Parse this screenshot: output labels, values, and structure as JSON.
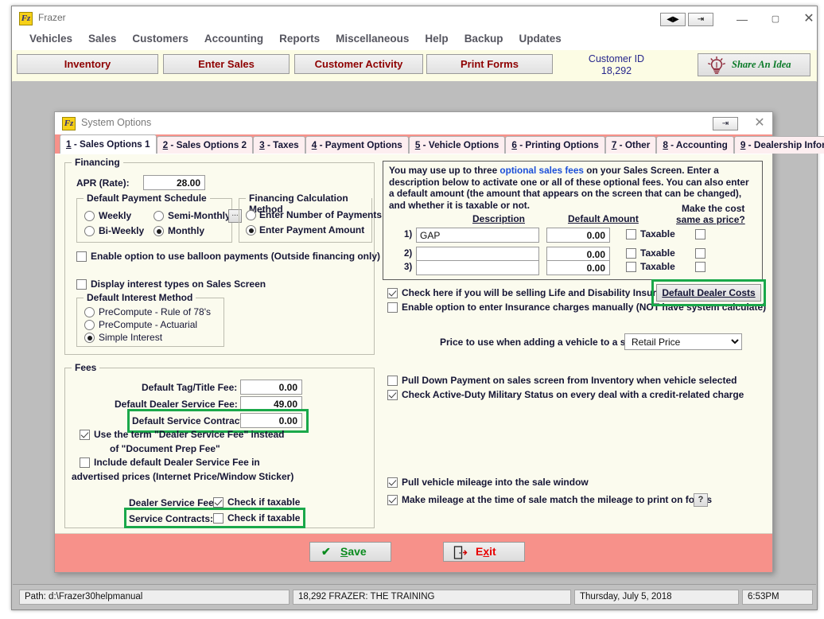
{
  "app": {
    "title": "Frazer",
    "icon": "frazer-logo-icon",
    "window_controls": {
      "restore_small": "◀▶",
      "popout": "⇥",
      "minimize": "—",
      "maximize": "▢",
      "close": "✕"
    }
  },
  "menubar": [
    {
      "label": "Vehicles"
    },
    {
      "label": "Sales"
    },
    {
      "label": "Customers"
    },
    {
      "label": "Accounting"
    },
    {
      "label": "Reports"
    },
    {
      "label": "Miscellaneous"
    },
    {
      "label": "Help"
    },
    {
      "label": "Backup"
    },
    {
      "label": "Updates"
    }
  ],
  "toolbar": {
    "inventory": "Inventory",
    "enter_sales": "Enter Sales",
    "customer_activity": "Customer Activity",
    "print_forms": "Print Forms",
    "customer_id_label": "Customer ID",
    "customer_id_value": "18,292",
    "share_idea": "Share An Idea"
  },
  "dialog": {
    "title": "System Options",
    "popout": "⇥",
    "close": "✕",
    "tabs": [
      {
        "num": "1",
        "label": " - Sales Options 1",
        "active": true
      },
      {
        "num": "2",
        "label": " - Sales Options 2",
        "active": false
      },
      {
        "num": "3",
        "label": " - Taxes",
        "active": false
      },
      {
        "num": "4",
        "label": " - Payment Options",
        "active": false
      },
      {
        "num": "5",
        "label": " - Vehicle Options",
        "active": false
      },
      {
        "num": "6",
        "label": " - Printing Options",
        "active": false
      },
      {
        "num": "7",
        "label": " - Other",
        "active": false
      },
      {
        "num": "8",
        "label": " - Accounting",
        "active": false
      },
      {
        "num": "9",
        "label": " - Dealership Information",
        "active": false
      }
    ]
  },
  "financing": {
    "group_title": "Financing",
    "apr_label": "APR (Rate):",
    "apr_value": "28.00",
    "schedule": {
      "title": "Default Payment Schedule",
      "options": [
        {
          "label": "Weekly",
          "selected": false
        },
        {
          "label": "Semi-Monthly",
          "selected": false
        },
        {
          "label": "Bi-Weekly",
          "selected": false
        },
        {
          "label": "Monthly",
          "selected": true
        }
      ],
      "dots_button": "..."
    },
    "calc_method": {
      "title": "Financing Calculation Method",
      "options": [
        {
          "label": "Enter Number of Payments",
          "selected": false
        },
        {
          "label": "Enter Payment Amount",
          "selected": true
        }
      ]
    },
    "balloon_checkbox": {
      "label": "Enable option to use balloon payments (Outside financing only)",
      "checked": false
    },
    "display_interest_checkbox": {
      "label": "Display interest types on Sales Screen",
      "checked": false
    },
    "interest_method": {
      "title": "Default Interest Method",
      "options": [
        {
          "label": "PreCompute - Rule of 78's",
          "selected": false
        },
        {
          "label": "PreCompute - Actuarial",
          "selected": false
        },
        {
          "label": "Simple Interest",
          "selected": true
        }
      ]
    }
  },
  "fees": {
    "group_title": "Fees",
    "tag_title_label": "Default Tag/Title Fee:",
    "tag_title_value": "0.00",
    "dealer_service_label": "Default Dealer Service Fee:",
    "dealer_service_value": "49.00",
    "service_contract_label": "Default Service Contract:",
    "service_contract_value": "0.00",
    "use_term_checkbox": {
      "line1": "Use the term \"Dealer Service Fee\" instead",
      "line2": "of \"Document Prep Fee\"",
      "checked": true
    },
    "include_default_checkbox": {
      "line1": "Include default  Dealer Service Fee in",
      "line2": "advertised prices (Internet Price/Window Sticker)",
      "checked": false
    },
    "dealer_service_tax_label": "Dealer Service Fee:",
    "dealer_service_tax_cb": {
      "label": "Check if taxable",
      "checked": true
    },
    "service_contracts_tax_label": "Service Contracts:",
    "service_contracts_tax_cb": {
      "label": "Check if taxable",
      "checked": false
    }
  },
  "optional_fees": {
    "intro_part1": "You may use up to three ",
    "intro_link": "optional sales fees",
    "intro_part2": " on your Sales Screen.  Enter a description below to activate one or all of these optional fees.  You can also enter a default amount (the amount that appears on the screen that can be changed), and whether it is taxable or not.",
    "col_description": "Description",
    "col_default_amount": "Default Amount",
    "col_cost_same_line1": "Make the cost",
    "col_cost_same_line2": "same as price?",
    "rows": [
      {
        "num": "1)",
        "description": "GAP",
        "amount": "0.00",
        "taxable_label": "Taxable",
        "taxable": false,
        "same_as_price": false
      },
      {
        "num": "2)",
        "description": "",
        "amount": "0.00",
        "taxable_label": "Taxable",
        "taxable": false,
        "same_as_price": false
      },
      {
        "num": "3)",
        "description": "",
        "amount": "0.00",
        "taxable_label": "Taxable",
        "taxable": false,
        "same_as_price": false
      }
    ]
  },
  "insurance": {
    "life_disability": {
      "label": "Check here if you will be selling Life and Disability Insurance",
      "checked": true
    },
    "manual_charges": {
      "label": "Enable option to enter Insurance charges manually (NOT have system calculate)",
      "checked": false
    },
    "default_dealer_costs_button": "Default Dealer Costs"
  },
  "price_option": {
    "label": "Price to use when adding a vehicle to a sale:",
    "selected": "Retail Price",
    "options": [
      "Retail Price"
    ]
  },
  "sales_options": {
    "pull_down_payment": {
      "label": "Pull Down Payment on sales screen from Inventory when vehicle selected",
      "checked": false
    },
    "military_status": {
      "label": "Check Active-Duty Military Status on every deal with a credit-related charge",
      "checked": true
    },
    "pull_mileage": {
      "label": "Pull vehicle mileage into the sale window",
      "checked": true
    },
    "match_mileage": {
      "label": "Make mileage at the time of sale match the mileage to print on forms",
      "checked": true
    },
    "help_button": "?"
  },
  "actions": {
    "save": "Save",
    "save_accel": "S",
    "exit": "Exit",
    "exit_accel": "x"
  },
  "statusbar": {
    "path": "Path: d:\\Frazer30helpmanual",
    "company": "18,292  FRAZER: THE TRAINING",
    "date": "Thursday, July  5, 2018",
    "time": "6:53PM"
  },
  "colors": {
    "accent_red": "#8e0000",
    "tabstrip": "#f7918a",
    "highlight_green": "#1aa84a",
    "link_blue": "#1b4fd8",
    "content_bg": "#fbfbee"
  }
}
